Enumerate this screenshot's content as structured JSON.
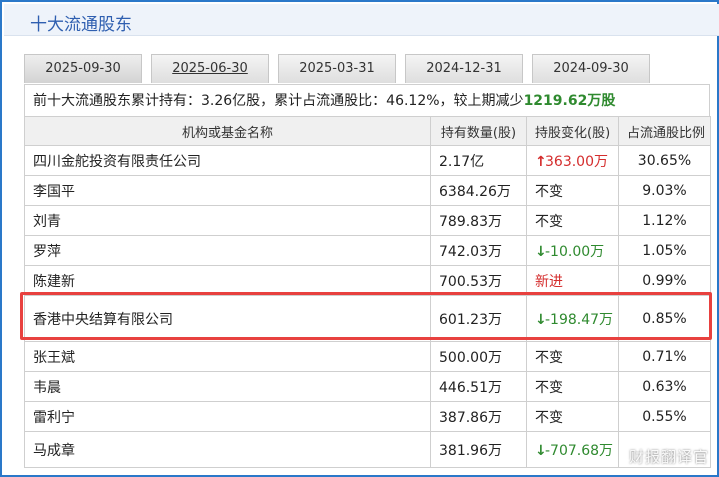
{
  "page": {
    "title": "十大流通股东"
  },
  "tabs": [
    {
      "label": "2025-09-30",
      "active": true
    },
    {
      "label": "2025-06-30",
      "active": false
    },
    {
      "label": "2025-03-31",
      "active": false
    },
    {
      "label": "2024-12-31",
      "active": false
    },
    {
      "label": "2024-09-30",
      "active": false
    }
  ],
  "summary": {
    "prefix": "前十大流通股东累计持有：3.26亿股，累计占流通股比：46.12%，较上期减少",
    "change": "1219.62万股"
  },
  "table": {
    "headers": [
      "机构或基金名称",
      "持有数量(股)",
      "持股变化(股)",
      "占流通股比例"
    ],
    "rows": [
      {
        "name": "四川金舵投资有限责任公司",
        "shares": "2.17亿",
        "change": "363.00万",
        "dir": "up",
        "pct": "30.65%"
      },
      {
        "name": "李国平",
        "shares": "6384.26万",
        "change": "不变",
        "dir": "same",
        "pct": "9.03%"
      },
      {
        "name": "刘青",
        "shares": "789.83万",
        "change": "不变",
        "dir": "same",
        "pct": "1.12%"
      },
      {
        "name": "罗萍",
        "shares": "742.03万",
        "change": "-10.00万",
        "dir": "down",
        "pct": "1.05%"
      },
      {
        "name": "陈建新",
        "shares": "700.53万",
        "change": "新进",
        "dir": "new",
        "pct": "0.99%"
      },
      {
        "name": "香港中央结算有限公司",
        "shares": "601.23万",
        "change": "-198.47万",
        "dir": "down",
        "pct": "0.85%"
      },
      {
        "name": "张王斌",
        "shares": "500.00万",
        "change": "不变",
        "dir": "same",
        "pct": "0.71%"
      },
      {
        "name": "韦晨",
        "shares": "446.51万",
        "change": "不变",
        "dir": "same",
        "pct": "0.63%"
      },
      {
        "name": "雷利宁",
        "shares": "387.86万",
        "change": "不变",
        "dir": "same",
        "pct": "0.55%"
      },
      {
        "name": "马成章",
        "shares": "381.96万",
        "change": "-707.68万",
        "dir": "down",
        "pct": ""
      }
    ]
  },
  "watermark": "财报翻译官",
  "colors": {
    "up": "#d42d2d",
    "down": "#2f8a2f",
    "highlight": "#e8413f",
    "title": "#2f5fb0"
  }
}
